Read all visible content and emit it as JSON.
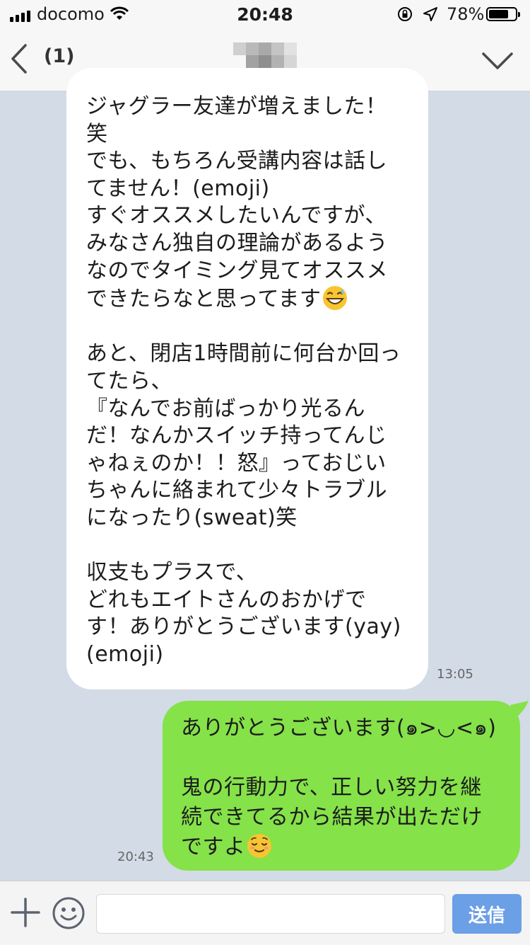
{
  "status_bar": {
    "carrier": "docomo",
    "time": "20:48",
    "battery": "78%",
    "battery_level": 0.78
  },
  "nav": {
    "unread_count": "(1)"
  },
  "messages": [
    {
      "direction": "incoming",
      "text": "ジャグラー友達が増えました！\n笑\nでも、もちろん受講内容は話し\nてません！(emoji)\nすぐオススメしたいんですが、\nみなさん独自の理論があるよう\nなのでタイミング見てオススメ\nできたらなと思ってます",
      "text2": "\n\nあと、閉店1時間前に何台か回っ\nてたら、\n『なんでお前ばっかり光るん\nだ！なんかスイッチ持ってんじ\nゃねぇのか！！怒』っておじい\nちゃんに絡まれて少々トラブル\nになったり(sweat)笑\n\n収支もプラスで、\nどれもエイトさんのおかげで\nす！ありがとうございます(yay)\n(emoji)",
      "emoji": "grinning-sweat-emoji",
      "time": "13:05"
    },
    {
      "direction": "outgoing",
      "text": "ありがとうございます(๑>◡<๑)\n\n鬼の行動力で、正しい努力を継\n続できてるから結果が出ただけ\nですよ",
      "emoji": "relieved-face-emoji",
      "time": "20:43"
    }
  ],
  "input": {
    "placeholder": "",
    "send_label": "送信"
  },
  "colors": {
    "background": "#d2dbe6",
    "incoming_bubble": "#ffffff",
    "outgoing_bubble": "#85e249",
    "send_button": "#6b9fe6"
  }
}
